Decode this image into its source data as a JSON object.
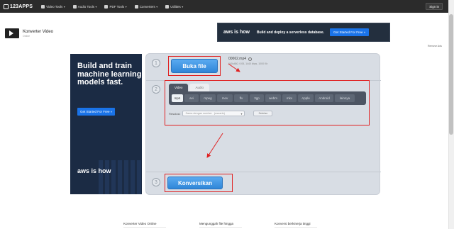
{
  "nav": {
    "logo": "123APPS",
    "items": [
      {
        "label": "Video Tools"
      },
      {
        "label": "Audio Tools"
      },
      {
        "label": "PDF Tools"
      },
      {
        "label": "Converters"
      },
      {
        "label": "Utilities"
      }
    ],
    "signin": "Sign in"
  },
  "app": {
    "title": "Konverter Video",
    "subtitle": "Online"
  },
  "ads": {
    "top": {
      "brand": "aws is how",
      "message": "Build and deploy a serverless database.",
      "cta": "Get Started For Free »"
    },
    "left": {
      "headline": "Build and train machine learning models fast.",
      "cta": "Get Started For Free »",
      "brand": "aws is how"
    },
    "remove": "Remove Ads"
  },
  "converter": {
    "steps": [
      "1",
      "2",
      "3"
    ],
    "open_button": "Buka file",
    "file": {
      "name": "00062.mp4",
      "info": "640x480, 0:05, 1440 kbps, 1000 Kb"
    },
    "tabs": [
      {
        "label": "Video",
        "active": true
      },
      {
        "label": "Audio",
        "active": false
      }
    ],
    "formats": [
      {
        "label": "mp4",
        "active": true
      },
      {
        "label": "avi",
        "active": false
      },
      {
        "label": "mpeg",
        "active": false
      },
      {
        "label": "mov",
        "active": false
      },
      {
        "label": "flv",
        "active": false
      },
      {
        "label": "3gp",
        "active": false
      },
      {
        "label": "webm",
        "active": false
      },
      {
        "label": "mkv",
        "active": false
      },
      {
        "label": "Apple",
        "active": false
      },
      {
        "label": "Android",
        "active": false
      },
      {
        "label": "lainnya",
        "active": false
      }
    ],
    "resolution_label": "Resolusi:",
    "resolution_value": "Sama dengan sumber",
    "resolution_hint": "(usuarte)",
    "settings_button": "Setelan",
    "convert_button": "Konversikan"
  },
  "footer": {
    "items": [
      "Konverter Video Online",
      "Mengunggah file hingga",
      "Konversi berkinerja tinggi"
    ]
  },
  "colors": {
    "accent": "#2f86d8",
    "annotation": "#e02020",
    "panel": "#d8dde4",
    "topbar": "#2b2b2b"
  }
}
